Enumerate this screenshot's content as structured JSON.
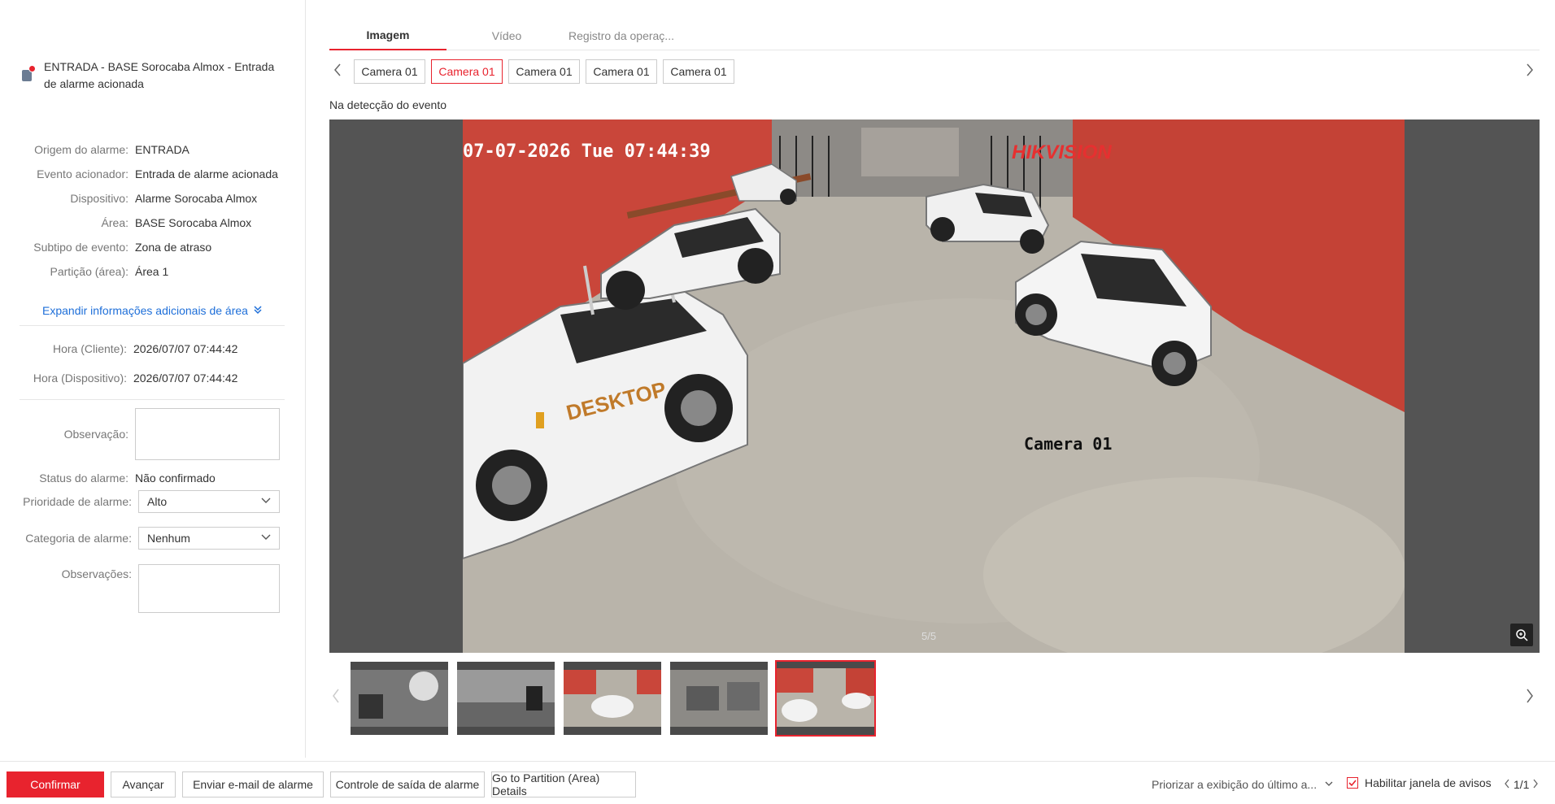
{
  "alarm": {
    "header_text": "ENTRADA - BASE Sorocaba Almox - Entrada de alarme acionada"
  },
  "info": [
    {
      "label": "Origem do alarme:",
      "value": "ENTRADA"
    },
    {
      "label": "Evento acionador:",
      "value": "Entrada de alarme acionada"
    },
    {
      "label": "Dispositivo:",
      "value": "Alarme Sorocaba Almox"
    },
    {
      "label": "Área:",
      "value": "BASE Sorocaba Almox"
    },
    {
      "label": "Subtipo de evento:",
      "value": "Zona de atraso"
    },
    {
      "label": "Partição (área):",
      "value": "Área 1"
    }
  ],
  "expand_label": "Expandir informações adicionais de área",
  "times": [
    {
      "label": "Hora (Cliente):",
      "value": "2026/07/07 07:44:42"
    },
    {
      "label": "Hora (Dispositivo):",
      "value": "2026/07/07 07:44:42"
    }
  ],
  "form": {
    "observacao_label": "Observação:",
    "status_label": "Status do alarme:",
    "status_value": "Não confirmado",
    "priority_label": "Prioridade de alarme:",
    "priority_value": "Alto",
    "category_label": "Categoria de alarme:",
    "category_value": "Nenhum",
    "observacoes_label": "Observações:"
  },
  "tabs": [
    "Imagem",
    "Vídeo",
    "Registro da operaç..."
  ],
  "cameras": [
    "Camera 01",
    "Camera 01",
    "Camera 01",
    "Camera 01",
    "Camera 01"
  ],
  "active_camera": 1,
  "detect_label": "Na detecção do evento",
  "image": {
    "timestamp_overlay": "07-07-2026 Tue 07:44:39",
    "brand_overlay": "HIKVISION",
    "camera_overlay": "Camera 01",
    "vehicle_brand": "DESKTOP",
    "pager": "5/5"
  },
  "thumbnails_count": 5,
  "active_thumbnail": 4,
  "bottom": {
    "confirm": "Confirmar",
    "advance": "Avançar",
    "email": "Enviar e-mail de alarme",
    "output": "Controle de saída de alarme",
    "partition": "Go to Partition (Area) Details",
    "priority_display": "Priorizar a exibição do último a...",
    "enable_popup": "Habilitar janela de avisos",
    "page": "1/1"
  },
  "colors": {
    "accent": "#e8232e",
    "link": "#1e6fd9",
    "wall": "#c9463a"
  }
}
